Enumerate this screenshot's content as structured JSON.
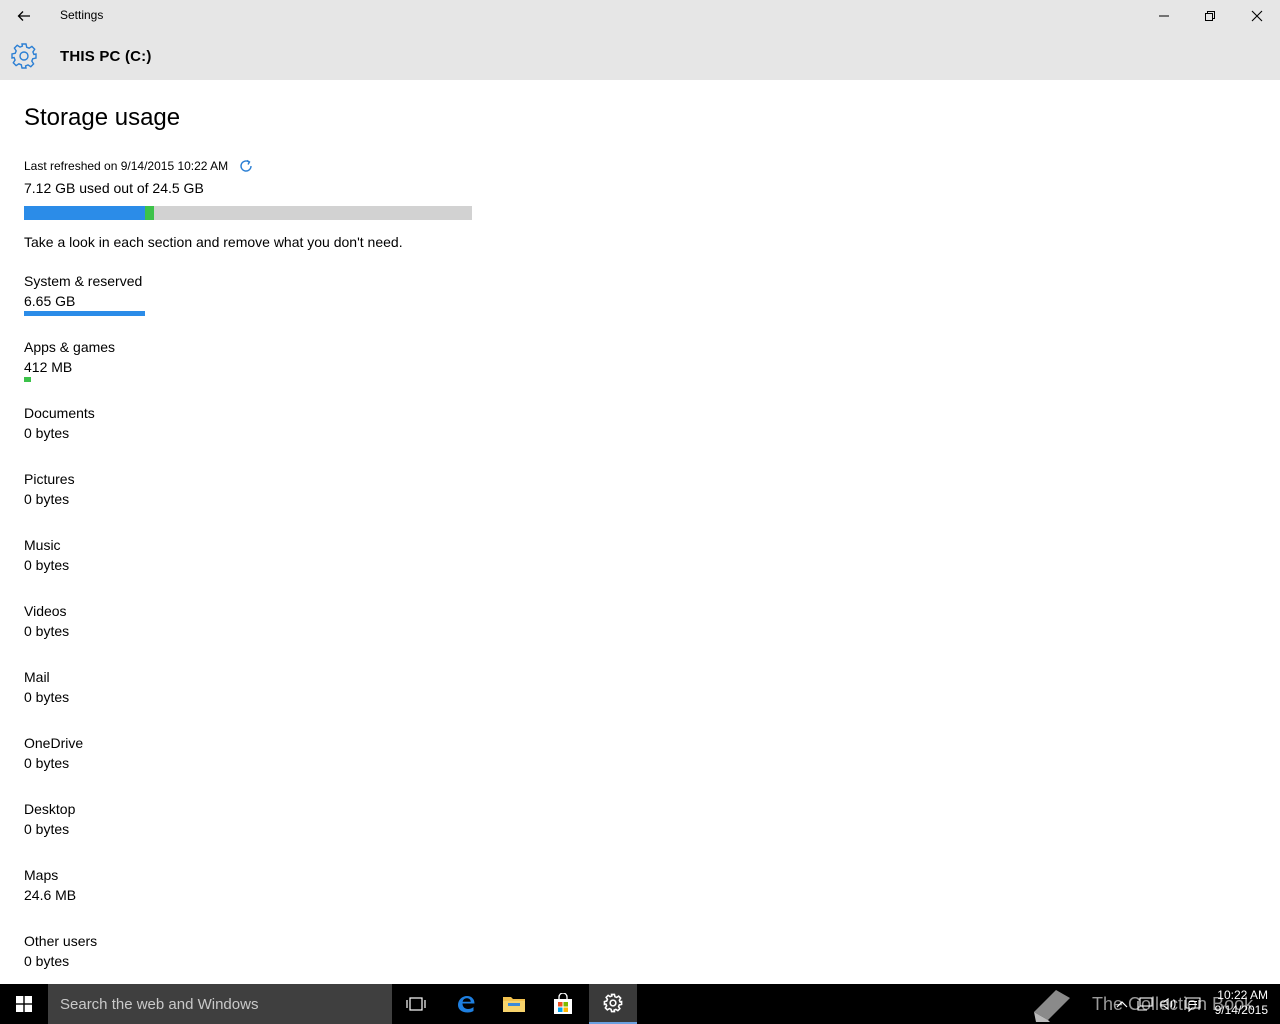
{
  "window": {
    "title": "Settings"
  },
  "header": {
    "title": "THIS PC (C:)"
  },
  "storage": {
    "heading": "Storage usage",
    "last_refreshed": "Last refreshed on 9/14/2015 10:22 AM",
    "used_text": "7.12 GB used out of 24.5 GB",
    "hint": "Take a look in each section and remove what you don't need.",
    "bar": {
      "system_fraction": 0.271,
      "apps_fraction": 0.016
    },
    "categories": [
      {
        "name": "System & reserved",
        "size": "6.65 GB",
        "fraction": 0.271,
        "color": "#2b8ce8"
      },
      {
        "name": "Apps & games",
        "size": "412 MB",
        "fraction": 0.016,
        "color": "#3cc24a"
      },
      {
        "name": "Documents",
        "size": "0 bytes"
      },
      {
        "name": "Pictures",
        "size": "0 bytes"
      },
      {
        "name": "Music",
        "size": "0 bytes"
      },
      {
        "name": "Videos",
        "size": "0 bytes"
      },
      {
        "name": "Mail",
        "size": "0 bytes"
      },
      {
        "name": "OneDrive",
        "size": "0 bytes"
      },
      {
        "name": "Desktop",
        "size": "0 bytes"
      },
      {
        "name": "Maps",
        "size": "24.6 MB"
      },
      {
        "name": "Other users",
        "size": "0 bytes"
      }
    ]
  },
  "taskbar": {
    "search_placeholder": "Search the web and Windows",
    "watermark": "The Collection Book",
    "time": "10:22 AM",
    "date": "9/14/2015"
  },
  "colors": {
    "accent": "#2b8ce8",
    "apps_green": "#3cc24a",
    "chrome_gray": "#e6e6e6",
    "bar_bg": "#d2d2d2"
  }
}
